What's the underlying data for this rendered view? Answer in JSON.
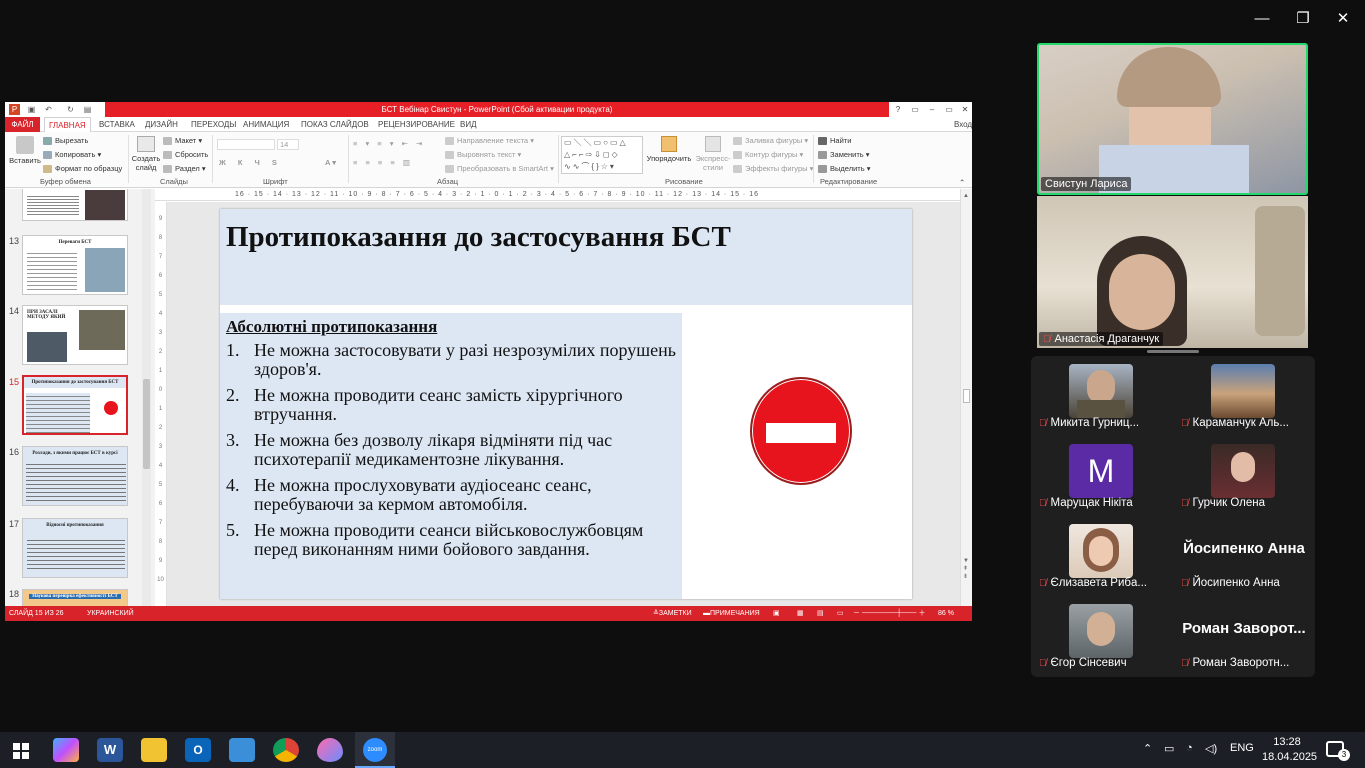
{
  "window_controls": {
    "minimize": "—",
    "restore": "❐",
    "close": "✕"
  },
  "powerpoint": {
    "title": "БСТ Вебінар Свистун - PowerPoint (Сбой активации продукта)",
    "title_help": "?",
    "title_min": "–",
    "title_restore": "▭",
    "title_close": "✕",
    "signin": "Вход",
    "tabs": [
      "ФАЙЛ",
      "ГЛАВНАЯ",
      "ВСТАВКА",
      "ДИЗАЙН",
      "ПЕРЕХОДЫ",
      "АНИМАЦИЯ",
      "ПОКАЗ СЛАЙДОВ",
      "РЕЦЕНЗИРОВАНИЕ",
      "ВИД"
    ],
    "ribbon": {
      "paste": "Вставить",
      "cut": "Вырезать",
      "copy": "Копировать",
      "format_painter": "Формат по образцу",
      "group_clipboard": "Буфер обмена",
      "new_slide": "Создать слайд",
      "layout": "Макет",
      "reset": "Сбросить",
      "section": "Раздел",
      "group_slides": "Слайды",
      "font_size": "14",
      "group_font": "Шрифт",
      "text_direction": "Направление текста",
      "align_text": "Выровнять текст",
      "smartart": "Преобразовать в SmartArt",
      "group_paragraph": "Абзац",
      "arrange": "Упорядочить",
      "quick_styles": "Экспресс-стили",
      "shape_fill": "Заливка фигуры",
      "shape_outline": "Контур фигуры",
      "shape_effects": "Эффекты фигуры",
      "group_drawing": "Рисование",
      "find": "Найти",
      "replace": "Заменить",
      "select": "Выделить",
      "group_editing": "Редактирование"
    },
    "ruler_marks": "16 · 15 · 14 · 13 · 12 · 11 · 10 · 9 · 8 · 7 · 6 · 5 · 4 · 3 · 2 · 1 · 0 · 1 · 2 · 3 · 4 · 5 · 6 · 7 · 8 · 9 · 10 · 11 · 12 · 13 · 14 · 15 · 16",
    "thumbnails": [
      {
        "num": "13",
        "title": "Переваги БСТ"
      },
      {
        "num": "14",
        "title": "ПРИ ЗАСАЛІ МЕТОДУ ЯКИЙ"
      },
      {
        "num": "15",
        "title": "Протипоказання до застосування БСТ"
      },
      {
        "num": "16",
        "title": "Розлади, з якими працює БСТ в курсі"
      },
      {
        "num": "17",
        "title": "Відносні протипоказання"
      },
      {
        "num": "18",
        "title": "Наукова перевірка ефективності БСТ"
      }
    ],
    "slide": {
      "title": "Протипоказання до застосування БСТ",
      "subtitle": "Абсолютні протипоказання",
      "items": [
        {
          "num": "1.",
          "text": "Не можна застосовувати у разі незрозумілих порушень здоров'я."
        },
        {
          "num": "2.",
          "text": "Не можна проводити сеанс замість хірургічного втручання."
        },
        {
          "num": "3.",
          "text": "Не можна без дозволу лікаря відміняти під час психотерапії медикаментозне лікування."
        },
        {
          "num": "4.",
          "text": "Не можна прослуховувати аудіосеанс сеанс, перебуваючи за кермом автомобіля."
        },
        {
          "num": "5.",
          "text": "Не можна проводити сеанси військовослужбовцям перед виконанням ними бойового завдання."
        }
      ]
    },
    "status": {
      "slide_count": "СЛАЙД 15 ИЗ 26",
      "language": "УКРАИНСКИЙ",
      "notes": "ЗАМЕТКИ",
      "comments": "ПРИМЕЧАНИЯ",
      "zoom": "86 %"
    }
  },
  "zoom": {
    "speaker": "Свистун Лариса",
    "second": "Анастасія Драганчук",
    "participants": [
      {
        "name": "Микита Гурниц...",
        "avatar_type": "photo"
      },
      {
        "name": "Караманчук Аль...",
        "avatar_type": "photo"
      },
      {
        "name": "Марущак Нікіта",
        "avatar_type": "letter",
        "letter": "M"
      },
      {
        "name": "Гурчик Олена",
        "avatar_type": "photo"
      },
      {
        "name": "Єлизавета Рибa...",
        "avatar_type": "photo"
      },
      {
        "name": "Йосипенко Анна",
        "avatar_type": "text",
        "big": "Йосипенко Анна"
      },
      {
        "name": "Єгор Сінсевич",
        "avatar_type": "photo"
      },
      {
        "name": "Роман Заворотн...",
        "avatar_type": "text",
        "big": "Роман Заворот..."
      }
    ]
  },
  "taskbar": {
    "lang": "ENG",
    "time": "13:28",
    "date": "18.04.2025",
    "notifications": "3"
  }
}
